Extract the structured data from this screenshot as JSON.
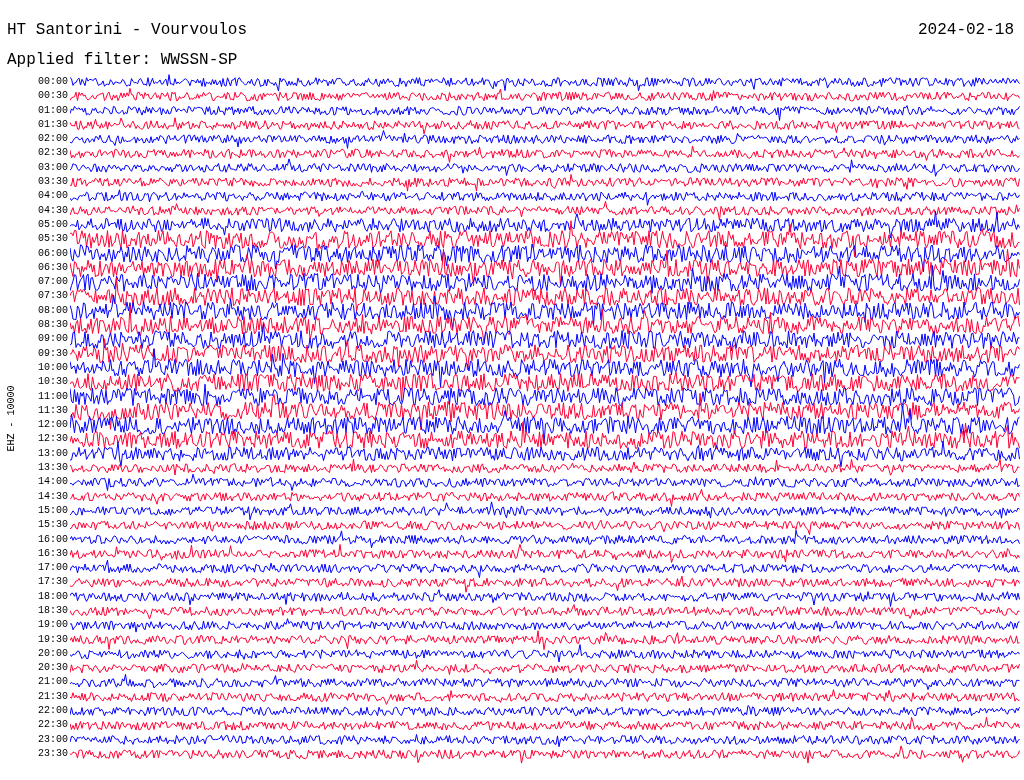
{
  "title": "HT Santorini - Vourvoulos",
  "date": "2024-02-18",
  "filter": "Applied filter: WWSSN-SP",
  "channel_label": "EHZ - 10000",
  "rows": [
    {
      "time": "00:00",
      "color": "#0000ff"
    },
    {
      "time": "00:30",
      "color": "#ff0033"
    },
    {
      "time": "01:00",
      "color": "#0000ff"
    },
    {
      "time": "01:30",
      "color": "#ff0033"
    },
    {
      "time": "02:00",
      "color": "#0000ff"
    },
    {
      "time": "02:30",
      "color": "#ff0033"
    },
    {
      "time": "03:00",
      "color": "#0000ff"
    },
    {
      "time": "03:30",
      "color": "#ff0033"
    },
    {
      "time": "04:00",
      "color": "#0000ff"
    },
    {
      "time": "04:30",
      "color": "#ff0033"
    },
    {
      "time": "05:00",
      "color": "#0000ff"
    },
    {
      "time": "05:30",
      "color": "#ff0033"
    },
    {
      "time": "06:00",
      "color": "#0000ff"
    },
    {
      "time": "06:30",
      "color": "#ff0033"
    },
    {
      "time": "07:00",
      "color": "#0000ff"
    },
    {
      "time": "07:30",
      "color": "#ff0033"
    },
    {
      "time": "08:00",
      "color": "#0000ff"
    },
    {
      "time": "08:30",
      "color": "#ff0033"
    },
    {
      "time": "09:00",
      "color": "#0000ff"
    },
    {
      "time": "09:30",
      "color": "#ff0033"
    },
    {
      "time": "10:00",
      "color": "#0000ff"
    },
    {
      "time": "10:30",
      "color": "#ff0033"
    },
    {
      "time": "11:00",
      "color": "#0000ff"
    },
    {
      "time": "11:30",
      "color": "#ff0033"
    },
    {
      "time": "12:00",
      "color": "#0000ff"
    },
    {
      "time": "12:30",
      "color": "#ff0033"
    },
    {
      "time": "13:00",
      "color": "#0000ff"
    },
    {
      "time": "13:30",
      "color": "#ff0033"
    },
    {
      "time": "14:00",
      "color": "#0000ff"
    },
    {
      "time": "14:30",
      "color": "#ff0033"
    },
    {
      "time": "15:00",
      "color": "#0000ff"
    },
    {
      "time": "15:30",
      "color": "#ff0033"
    },
    {
      "time": "16:00",
      "color": "#0000ff"
    },
    {
      "time": "16:30",
      "color": "#ff0033"
    },
    {
      "time": "17:00",
      "color": "#0000ff"
    },
    {
      "time": "17:30",
      "color": "#ff0033"
    },
    {
      "time": "18:00",
      "color": "#0000ff"
    },
    {
      "time": "18:30",
      "color": "#ff0033"
    },
    {
      "time": "19:00",
      "color": "#0000ff"
    },
    {
      "time": "19:30",
      "color": "#ff0033"
    },
    {
      "time": "20:00",
      "color": "#0000ff"
    },
    {
      "time": "20:30",
      "color": "#ff0033"
    },
    {
      "time": "21:00",
      "color": "#0000ff"
    },
    {
      "time": "21:30",
      "color": "#ff0033"
    },
    {
      "time": "22:00",
      "color": "#0000ff"
    },
    {
      "time": "22:30",
      "color": "#ff0033"
    },
    {
      "time": "23:00",
      "color": "#0000ff"
    },
    {
      "time": "23:30",
      "color": "#ff0033"
    }
  ]
}
